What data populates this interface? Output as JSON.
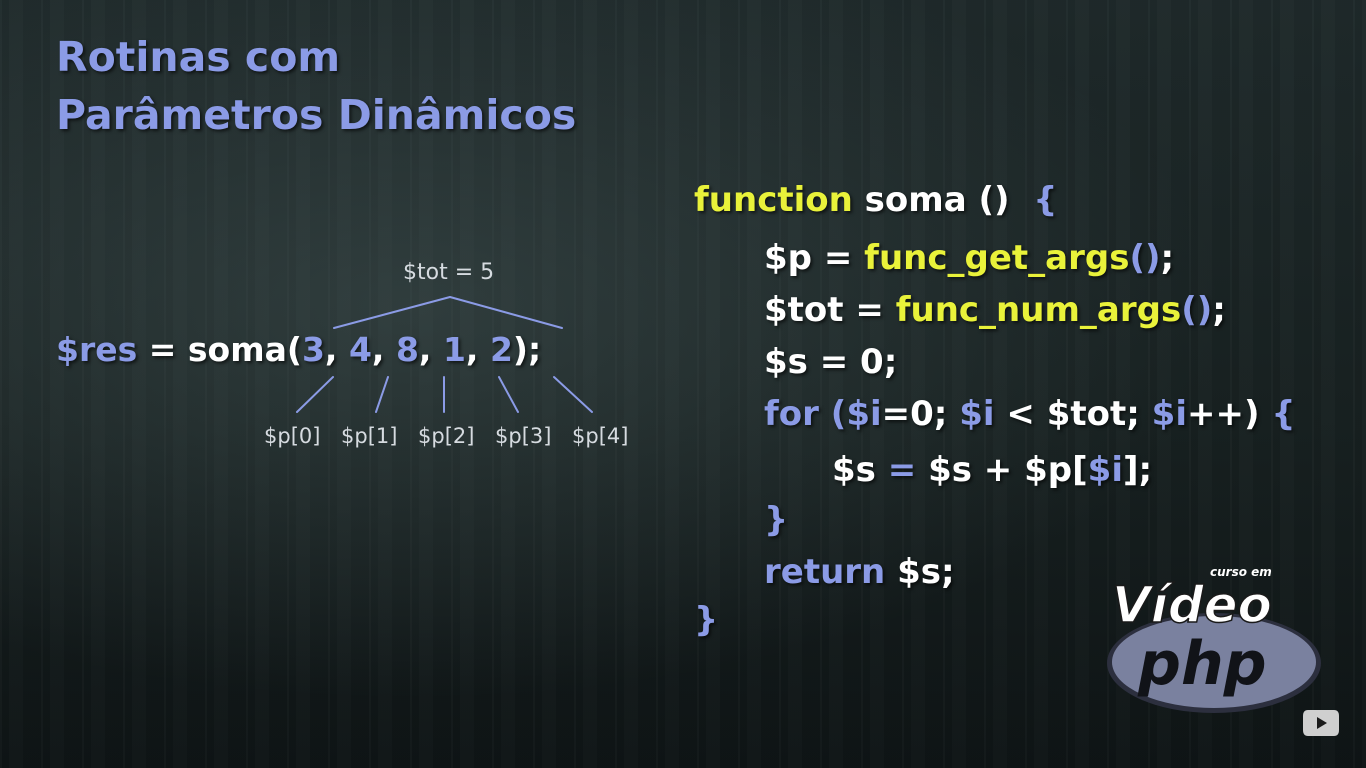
{
  "title": {
    "line1": "Rotinas com",
    "line2": "Parâmetros Dinâmicos"
  },
  "call": {
    "var": "$res",
    "eq": " = soma(",
    "args": [
      "3",
      "4",
      "8",
      "1",
      "2"
    ],
    "sep": ", ",
    "end": ");"
  },
  "diagram": {
    "tot_label": "$tot = 5",
    "param_labels": [
      "$p[0]",
      "$p[1]",
      "$p[2]",
      "$p[3]",
      "$p[4]"
    ]
  },
  "code": {
    "l1_kw": "function",
    "l1_rest": " soma ()  ",
    "l1_brace": "{",
    "l2_var": "$p",
    "l2_eq": " = ",
    "l2_fn": "func_get_args",
    "l2_paren": "()",
    "l2_end": ";",
    "l3_var": "$tot",
    "l3_eq": " = ",
    "l3_fn": "func_num_args",
    "l3_paren": "()",
    "l3_end": ";",
    "l4": "$s = 0;",
    "l5_kw": "for",
    "l5_open": " (",
    "l5_v1": "$i",
    "l5_a": "=0; ",
    "l5_v2": "$i",
    "l5_b": " < $tot; ",
    "l5_v3": "$i",
    "l5_c": "++) ",
    "l5_brace": "{",
    "l6_a": "$s ",
    "l6_eq": "=",
    "l6_b": " $s + $p[",
    "l6_v": "$i",
    "l6_c": "];",
    "l7": "}",
    "l8_kw": "return",
    "l8_rest": " $s;",
    "l9": "}"
  },
  "logo": {
    "small": "curso em",
    "main": "Vídeo",
    "sub": "php"
  },
  "colors": {
    "accent_blue": "#8b9be6",
    "accent_yellow": "#e9f23a",
    "text_white": "#ffffff",
    "label_gray": "#d6dbe0"
  }
}
